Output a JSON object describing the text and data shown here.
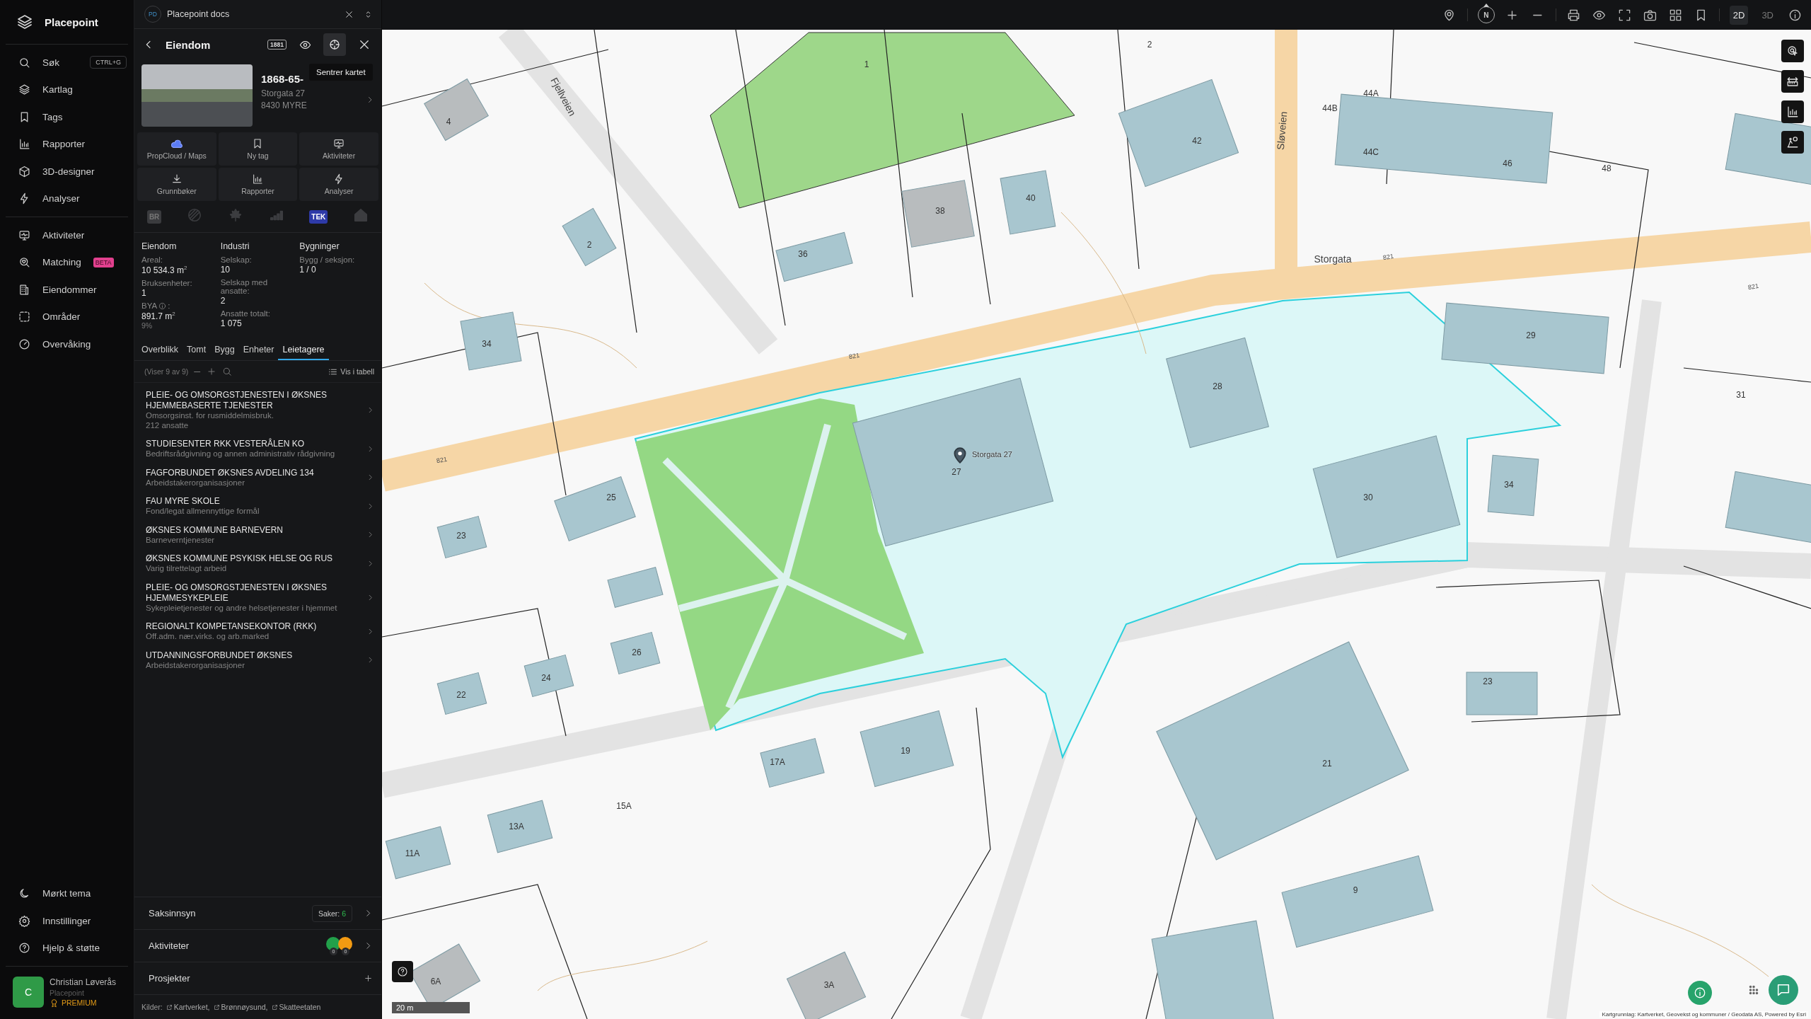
{
  "sidebar": {
    "brand": "Placepoint",
    "nav": [
      {
        "label": "Søk",
        "shortcut": "CTRL+G"
      },
      {
        "label": "Kartlag"
      },
      {
        "label": "Tags"
      },
      {
        "label": "Rapporter"
      },
      {
        "label": "3D-designer"
      },
      {
        "label": "Analyser"
      }
    ],
    "nav_2": [
      {
        "label": "Aktiviteter"
      },
      {
        "label": "Matching",
        "badge": "BETA"
      },
      {
        "label": "Eiendommer"
      },
      {
        "label": "Områder"
      },
      {
        "label": "Overvåking"
      }
    ],
    "footer_nav": [
      {
        "label": "Mørkt tema"
      },
      {
        "label": "Innstillinger"
      },
      {
        "label": "Hjelp & støtte"
      }
    ],
    "user": {
      "initial": "C",
      "name": "Christian Løverås",
      "org": "Placepoint",
      "plan": "PREMIUM"
    }
  },
  "panel": {
    "app": {
      "initials": "PD",
      "title": "Placepoint docs"
    },
    "header": {
      "title": "Eiendom",
      "badge": "1881",
      "tooltip": "Sentrer kartet"
    },
    "property": {
      "id": "1868-65-",
      "address": "Storgata 27",
      "postal": "8430 MYRE"
    },
    "actions": [
      "PropCloud / Maps",
      "Ny tag",
      "Aktiviteter",
      "Grunnbøker",
      "Rapporter",
      "Analyser"
    ],
    "sources": [
      {
        "kind": "badge",
        "label": "BR",
        "active": false
      },
      {
        "kind": "icon",
        "active": false
      },
      {
        "kind": "icon",
        "active": false
      },
      {
        "kind": "icon",
        "active": false
      },
      {
        "kind": "badge",
        "label": "TEK",
        "active": true
      },
      {
        "kind": "icon",
        "active": false
      }
    ],
    "stats": [
      {
        "heading": "Eiendom",
        "fields": [
          {
            "label": "Areal:",
            "value": "10 534.3 m$^{2}$"
          },
          {
            "label": "Bruksenheter:",
            "value": "1"
          },
          {
            "label": "BYA",
            "info": true,
            "label_end": ":",
            "value": "891.7 m$^{2}$",
            "note": "9%"
          }
        ]
      },
      {
        "heading": "Industri",
        "fields": [
          {
            "label": "Selskap:",
            "value": "10"
          },
          {
            "label": "Selskap med ansatte:",
            "value": "2"
          },
          {
            "label": "Ansatte totalt:",
            "value": "1 075"
          }
        ]
      },
      {
        "heading": "Bygninger",
        "fields": [
          {
            "label": "Bygg / seksjon:",
            "value": "1 / 0"
          }
        ]
      }
    ],
    "tabs": [
      {
        "label": "Overblikk",
        "selected": false
      },
      {
        "label": "Tomt",
        "selected": false
      },
      {
        "label": "Bygg",
        "selected": false
      },
      {
        "label": "Enheter",
        "selected": false
      },
      {
        "label": "Leietagere",
        "selected": true
      }
    ],
    "list_toolbar": {
      "count": "(Viser 9 av 9)",
      "table_button": "Vis i tabell"
    },
    "tenants": [
      {
        "name": "PLEIE- OG OMSORGSTJENESTEN I ØKSNES HJEMMEBASERTE TJENESTER",
        "description": "Omsorgsinst. for rusmiddelmisbruk.",
        "employees": "212 ansatte"
      },
      {
        "name": "STUDIESENTER RKK VESTERÅLEN KO",
        "description": "Bedriftsrådgivning og annen administrativ rådgivning"
      },
      {
        "name": "FAGFORBUNDET ØKSNES AVDELING 134",
        "description": "Arbeidstakerorganisasjoner"
      },
      {
        "name": "FAU MYRE SKOLE",
        "description": "Fond/legat allmennyttige formål"
      },
      {
        "name": "ØKSNES KOMMUNE BARNEVERN",
        "description": "Barneverntjenester"
      },
      {
        "name": "ØKSNES KOMMUNE PSYKISK HELSE OG RUS",
        "description": "Varig tilrettelagt arbeid"
      },
      {
        "name": "PLEIE- OG OMSORGSTJENESTEN I ØKSNES HJEMMESYKEPLEIE",
        "description": "Sykepleietjenester og andre helsetjenester i hjemmet"
      },
      {
        "name": "REGIONALT KOMPETANSEKONTOR (RKK)",
        "description": "Off.adm. nær.virks. og arb.marked"
      },
      {
        "name": "UTDANNINGSFORBUNDET ØKSNES",
        "description": "Arbeidstakerorganisasjoner"
      }
    ],
    "sections": [
      {
        "kind": "count",
        "label": "Saksinnsyn",
        "badge_label": "Saker:",
        "badge_value": "6"
      },
      {
        "kind": "activities",
        "label": "Aktiviteter",
        "counts": [
          {
            "count": "0",
            "color": "#22a04a"
          },
          {
            "count": "0",
            "color": "#f29a12"
          }
        ]
      },
      {
        "kind": "add",
        "label": "Prosjekter"
      }
    ],
    "footer": {
      "label": "Kilder:",
      "links": [
        "Kartverket,",
        "Brønnøysund,",
        "Skatteetaten"
      ]
    }
  },
  "map": {
    "compass": "N",
    "modes": [
      {
        "label": "2D",
        "selected": true
      },
      {
        "label": "3D",
        "selected": false
      }
    ],
    "house_numbers": [
      "1",
      "2",
      "4",
      "42",
      "44A",
      "44B",
      "44C",
      "46",
      "48",
      "36",
      "38",
      "40",
      "2",
      "34",
      "29",
      "28",
      "31",
      "25",
      "23",
      "30",
      "34",
      "27",
      "26",
      "24",
      "22",
      "17A",
      "19",
      "15A",
      "13A",
      "11A",
      "21",
      "23",
      "9",
      "6A",
      "3A"
    ],
    "streets": [
      "Fjellveien",
      "Storgata",
      "Sløveien"
    ],
    "road_numbers": [
      "821",
      "821",
      "821",
      "821"
    ],
    "marker_label": "Storgata 27",
    "scale": "20 m",
    "attribution": "Kartgrunnlag: Kartverket, Geovekst og kommuner / Geodata AS, Powered by Esri"
  }
}
